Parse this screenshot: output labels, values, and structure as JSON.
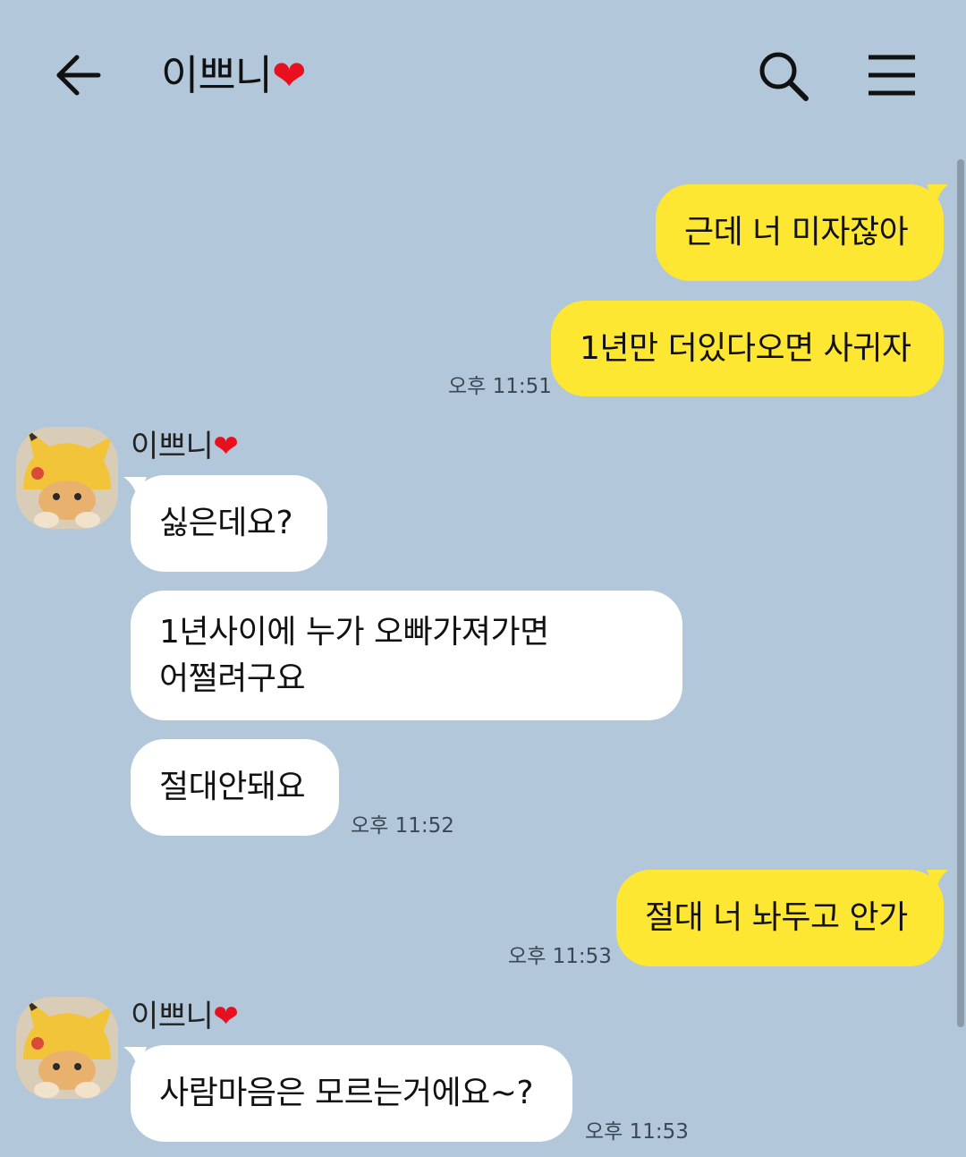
{
  "header": {
    "title": "이쁘니",
    "heart": "❤",
    "icons": {
      "back": "arrow-left-icon",
      "search": "search-icon",
      "menu": "hamburger-menu-icon"
    }
  },
  "colors": {
    "background": "#b2c7da",
    "my_bubble": "#fee733",
    "their_bubble": "#ffffff",
    "heart": "#e8101e"
  },
  "messages": [
    {
      "sender": "me",
      "text": "근데 너 미자잖아"
    },
    {
      "sender": "me",
      "text": "1년만 더있다오면 사귀자",
      "time": "오후 11:51"
    },
    {
      "sender": "other",
      "name": "이쁘니",
      "heart": "❤",
      "text": "싫은데요?"
    },
    {
      "sender": "other",
      "text_lines": [
        "1년사이에 누가 오빠가져가면",
        "어쩔려구요"
      ]
    },
    {
      "sender": "other",
      "text": "절대안돼요",
      "time": "오후 11:52"
    },
    {
      "sender": "me",
      "text": "절대 너 놔두고 안가",
      "time": "오후 11:53"
    },
    {
      "sender": "other",
      "name": "이쁘니",
      "heart": "❤",
      "text": "사람마음은 모르는거에요~?",
      "time": "오후 11:53"
    }
  ]
}
